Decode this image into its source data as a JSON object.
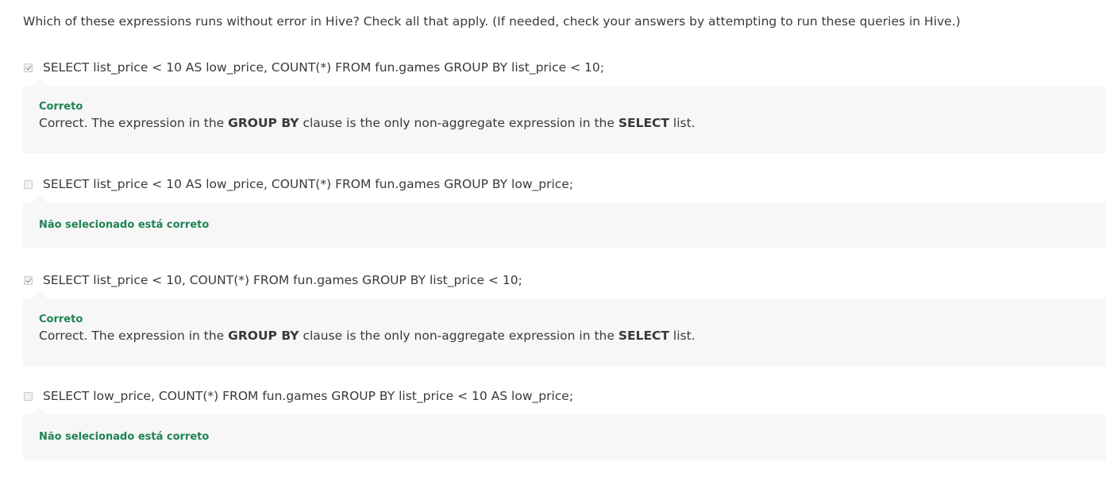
{
  "question": "Which of these expressions runs without error in Hive? Check all that apply. (If needed, check your answers by attempting to run these queries in Hive.)",
  "options": [
    {
      "checked": true,
      "label": "SELECT list_price < 10 AS low_price, COUNT(*) FROM fun.games GROUP BY list_price < 10;",
      "feedback_status": "Correto",
      "feedback": {
        "prefix": "Correct. The expression in the ",
        "kw1": "GROUP BY",
        "mid": " clause is the only non-aggregate expression in the ",
        "kw2": "SELECT",
        "suffix": " list."
      }
    },
    {
      "checked": false,
      "label": "SELECT list_price < 10 AS low_price, COUNT(*) FROM fun.games GROUP BY low_price;",
      "feedback_status": "Não selecionado está correto"
    },
    {
      "checked": true,
      "label": "SELECT list_price < 10, COUNT(*) FROM fun.games GROUP BY list_price < 10;",
      "feedback_status": "Correto",
      "feedback": {
        "prefix": "Correct. The expression in the ",
        "kw1": "GROUP BY",
        "mid": " clause is the only non-aggregate expression in the ",
        "kw2": "SELECT",
        "suffix": " list."
      }
    },
    {
      "checked": false,
      "label": "SELECT low_price, COUNT(*) FROM fun.games GROUP BY list_price < 10 AS low_price;",
      "feedback_status": "Não selecionado está correto"
    }
  ],
  "colors": {
    "correct_green": "#1f8354",
    "feedback_bg": "#f7f7f7",
    "text": "#373a3c"
  }
}
